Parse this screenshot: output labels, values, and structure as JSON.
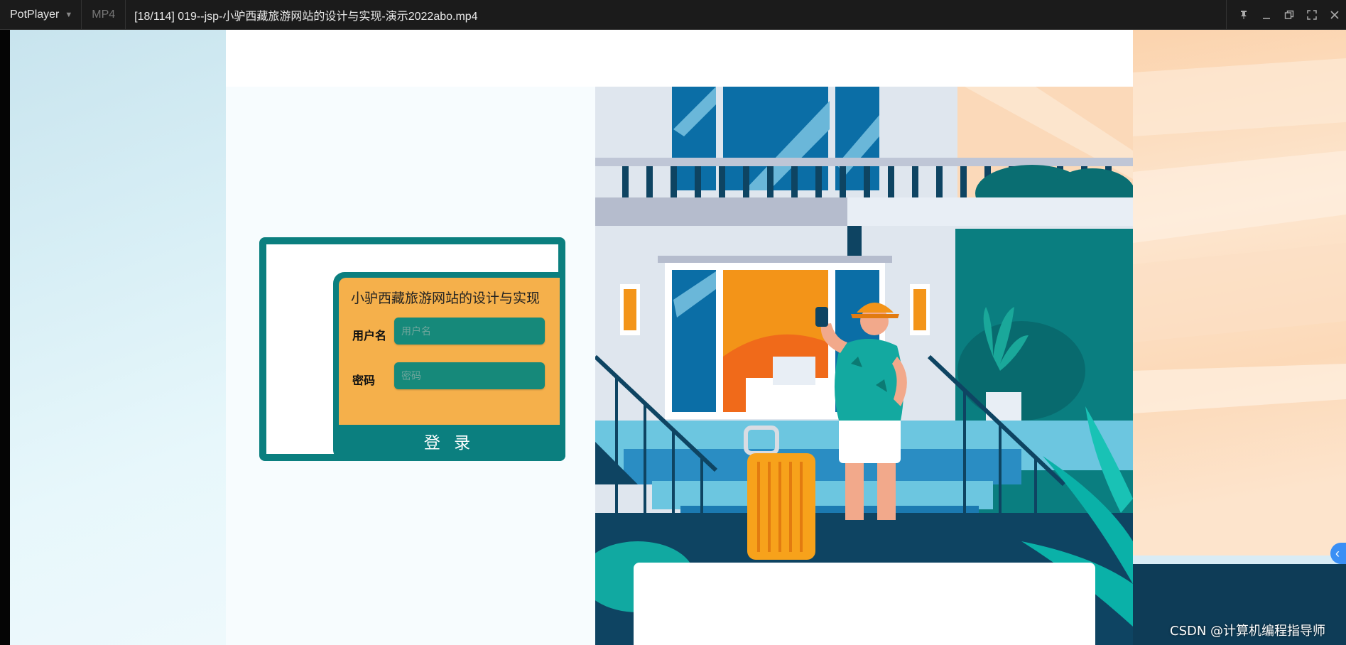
{
  "titlebar": {
    "app_name": "PotPlayer",
    "format": "MP4",
    "video_title": "[18/114] 019--jsp-小驴西藏旅游网站的设计与实现-演示2022abo.mp4"
  },
  "login": {
    "title": "小驴西藏旅游网站的设计与实现",
    "username_label": "用户名",
    "username_placeholder": "用户名",
    "password_label": "密码",
    "password_placeholder": "密码",
    "submit_label": "登 录"
  },
  "watermark": "CSDN @计算机编程指导师",
  "colors": {
    "teal": "#0b7f7f",
    "orange": "#f5b04b",
    "input": "#16897a",
    "sidebar_toggle": "#3a8ff5"
  },
  "icons": {
    "dropdown": "chevron-down-icon",
    "pin": "pin-icon",
    "minimize": "minimize-icon",
    "restore": "restore-icon",
    "fullscreen": "fullscreen-icon",
    "close": "close-icon",
    "sidebar": "chevron-left-icon"
  }
}
